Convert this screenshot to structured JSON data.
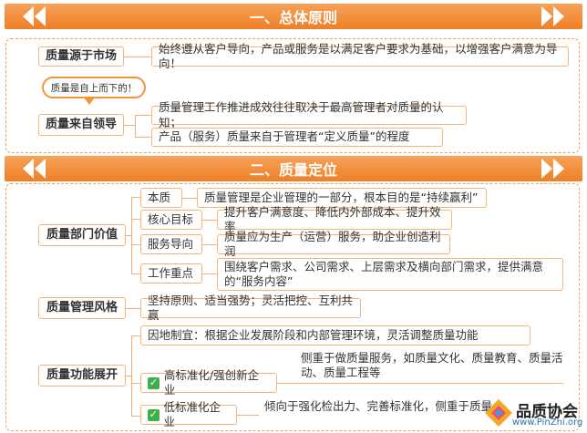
{
  "section1": {
    "title": "一、总体原则",
    "market": {
      "key": "质量源于市场",
      "desc": "始终遵从客户导向，产品或服务是以满足客户要求为基础，以增强客户满意为导向！"
    },
    "bubble": "质量是自上而下的！",
    "leader": {
      "key": "质量来自领导",
      "items": [
        "质量管理工作推进成效往往取决于最高管理者对质量的认知；",
        "产品（服务）质量来自于管理者“定义质量”的程度"
      ]
    }
  },
  "section2": {
    "title": "二、质量定位",
    "value": {
      "key": "质量部门价值",
      "rows": [
        {
          "label": "本质",
          "desc": "质量管理是企业管理的一部分，根本目的是“持续赢利”"
        },
        {
          "label": "核心目标",
          "desc": "提升客户满意度、降低内外部成本、提升效率"
        },
        {
          "label": "服务导向",
          "desc": "质量应为生产（运营）服务，助企业创造利润"
        },
        {
          "label": "工作重点",
          "desc": "围绕客户需求、公司需求、上层需求及横向部门需求，提供满意的“服务内容”"
        }
      ]
    },
    "style": {
      "key": "质量管理风格",
      "desc": "坚持原则、适当强势；灵活把控、互利共赢"
    },
    "function": {
      "key": "质量功能展开",
      "adapt": "因地制宜：根据企业发展阶段和内部管理环境，灵活调整质量功能",
      "high": {
        "label": "高标准化/强创新企业",
        "desc": "侧重于做质量服务，如质量文化、质量教育、质量活动、质量工程等"
      },
      "low": {
        "label": "低标准化企业",
        "desc": "倾向于强化检出力、完善标准化，侧重于质量"
      }
    }
  },
  "watermark": {
    "brand": "品质协会",
    "url": "www.PinZhi.org"
  },
  "colors": {
    "accent": "#ef7f25",
    "border": "#f3b37c",
    "check": "#3fb049"
  }
}
